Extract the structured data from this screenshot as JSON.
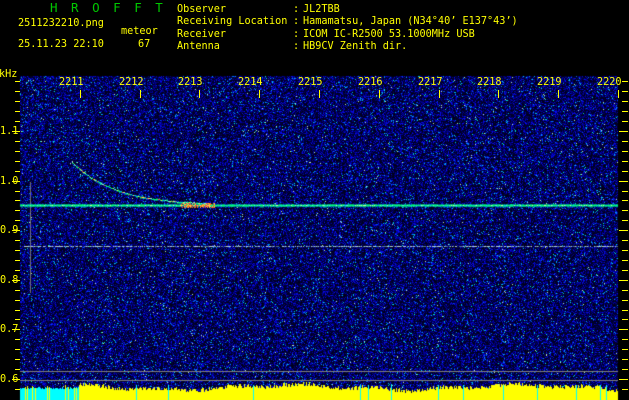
{
  "header": {
    "app_title": "H R O F F T",
    "filename": "2511232210.png",
    "datetime": "25.11.23 22:10",
    "event_type": "meteor",
    "event_count": "67",
    "info_separator": ":",
    "info": [
      {
        "label": "Observer",
        "value": "JL2TBB"
      },
      {
        "label": "Receiving Location",
        "value": "Hamamatsu, Japan (N34°40’ E137°43’)"
      },
      {
        "label": "Receiver",
        "value": "ICOM IC-R2500 53.1000MHz USB"
      },
      {
        "label": "Antenna",
        "value": "HB9CV Zenith dir."
      }
    ]
  },
  "chart_data": {
    "type": "heatmap",
    "title": "",
    "xlabel": "",
    "ylabel": "kHz",
    "x_tick_labels": [
      "2211",
      "2212",
      "2213",
      "2214",
      "2215",
      "2216",
      "2217",
      "2218",
      "2219",
      "2220"
    ],
    "x_ticks_minutes": [
      1,
      2,
      3,
      4,
      5,
      6,
      7,
      8,
      9,
      10
    ],
    "x_range_minutes": [
      0,
      10
    ],
    "x_start_time": "22:10",
    "y_tick_labels": [
      "1.1",
      "1.0",
      "0.9",
      "0.8",
      "0.7",
      "0.6"
    ],
    "y_ticks": [
      1.1,
      1.0,
      0.9,
      0.8,
      0.7,
      0.6
    ],
    "y_minor_step": 0.02,
    "y_range": [
      0.59,
      1.21
    ],
    "grid": false,
    "legend": null,
    "colors": {
      "background": "#000000",
      "title_green": "#00c800",
      "text_yellow": "#ffff00",
      "noise_blue": "#0000c0",
      "carrier": "#00ff78",
      "echo": "#99ff66",
      "burst": "#ff6600",
      "faint_line": "#aac8c8",
      "threshold_line": "#808080",
      "bar_signal": "#ffff00",
      "bar_quiet": "#00ffff"
    },
    "features": [
      {
        "name": "carrier-line",
        "kind": "horizontal-line",
        "freq_khz": 0.951,
        "from_min": 0,
        "to_min": 10,
        "color": "#00ff78"
      },
      {
        "name": "meteor-head-echo",
        "kind": "curve",
        "color": "#99ff66",
        "points": [
          [
            0.87,
            1.038
          ],
          [
            1.0,
            1.023
          ],
          [
            1.2,
            1.005
          ],
          [
            1.4,
            0.992
          ],
          [
            1.6,
            0.982
          ],
          [
            1.8,
            0.974
          ],
          [
            2.0,
            0.968
          ],
          [
            2.2,
            0.964
          ],
          [
            2.4,
            0.961
          ],
          [
            2.6,
            0.958
          ],
          [
            2.85,
            0.956
          ],
          [
            3.1,
            0.954
          ]
        ]
      },
      {
        "name": "echo-burst",
        "kind": "blob",
        "from_min": 2.7,
        "to_min": 3.25,
        "freq_khz": 0.951,
        "color": "#ff6600"
      },
      {
        "name": "faint-line",
        "kind": "horizontal-line",
        "freq_khz": 0.868,
        "from_min": 0,
        "to_min": 10,
        "color": "#aac8c8"
      },
      {
        "name": "threshold-line-upper",
        "kind": "horizontal-line",
        "freq_khz": 0.616,
        "from_min": 0,
        "to_min": 10,
        "color": "#808080"
      },
      {
        "name": "threshold-line-lower",
        "kind": "horizontal-line",
        "freq_khz": 0.597,
        "from_min": 0,
        "to_min": 10,
        "color": "#808080"
      },
      {
        "name": "marker-line",
        "kind": "vertical-line",
        "time_min": 0.17,
        "from_khz": 0.773,
        "to_khz": 0.997,
        "color": "#787878"
      }
    ],
    "amplitude_bars": {
      "quiet_end_min": 0.97,
      "quiet_color": "#00ffff",
      "signal_color": "#ffff00"
    }
  }
}
